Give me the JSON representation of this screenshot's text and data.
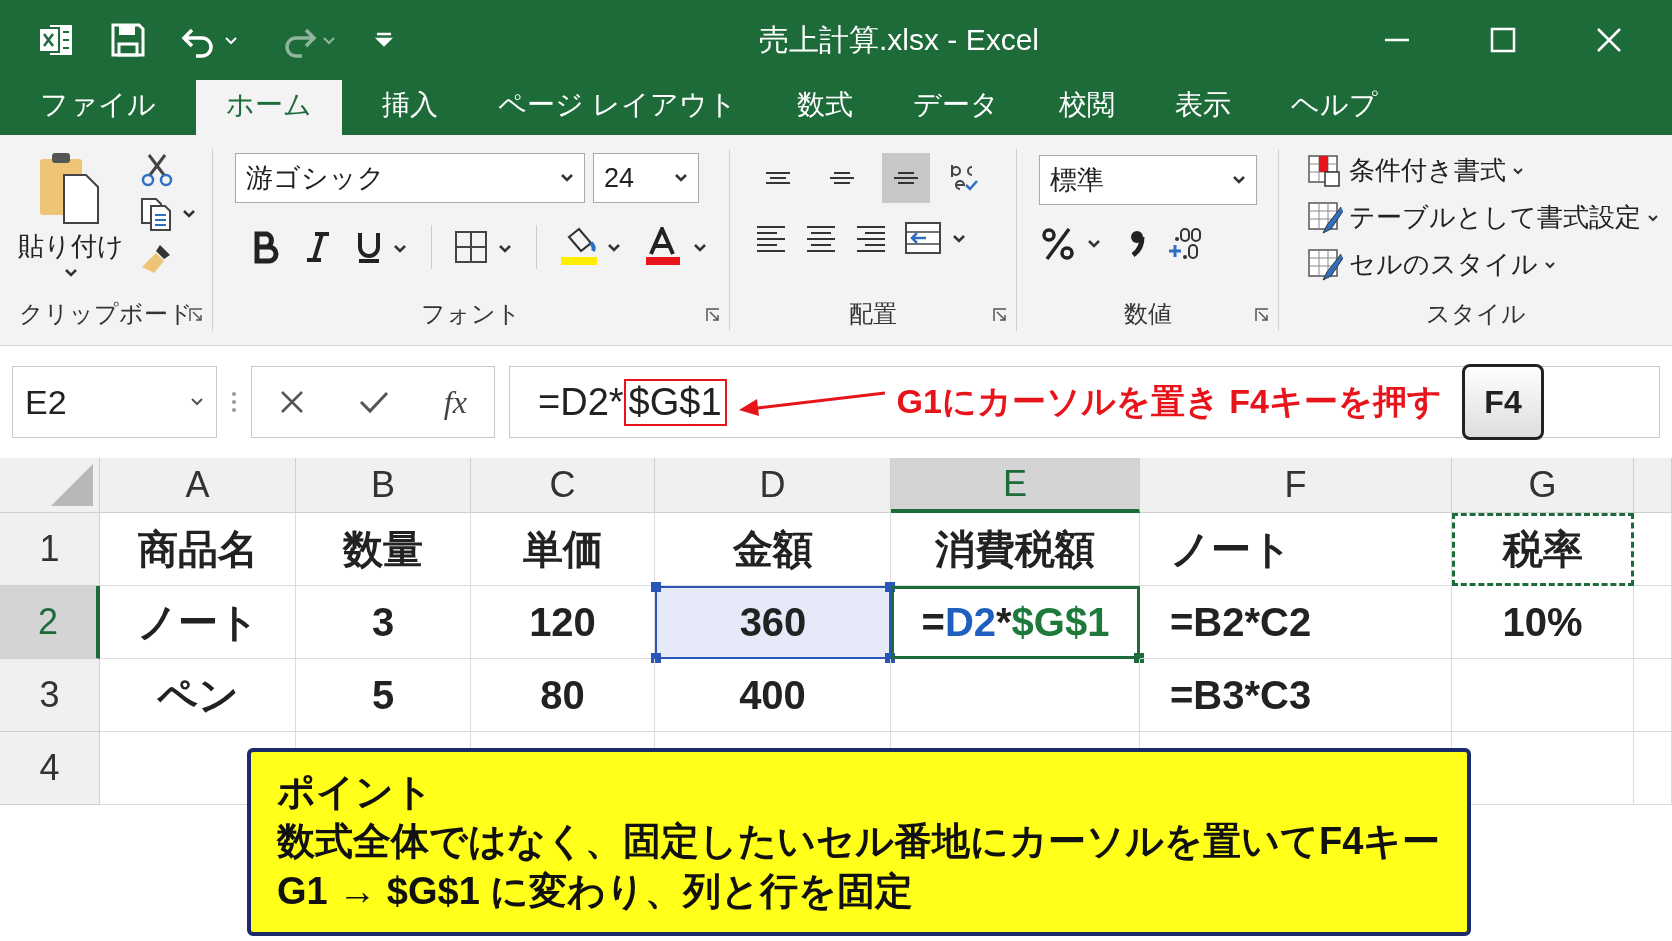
{
  "window": {
    "title": "売上計算.xlsx  -  Excel"
  },
  "ribbon_tabs": [
    {
      "label": "ファイル",
      "selected": false
    },
    {
      "label": "ホーム",
      "selected": true
    },
    {
      "label": "挿入",
      "selected": false
    },
    {
      "label": "ページ レイアウト",
      "selected": false
    },
    {
      "label": "数式",
      "selected": false
    },
    {
      "label": "データ",
      "selected": false
    },
    {
      "label": "校閲",
      "selected": false
    },
    {
      "label": "表示",
      "selected": false
    },
    {
      "label": "ヘルプ",
      "selected": false
    }
  ],
  "ribbon": {
    "clipboard": {
      "paste_label": "貼り付け",
      "group_label": "クリップボード"
    },
    "font": {
      "font_name": "游ゴシック",
      "font_size": "24",
      "group_label": "フォント"
    },
    "alignment": {
      "vertical_align": [
        {
          "selected": false
        },
        {
          "selected": false
        },
        {
          "selected": true
        }
      ],
      "group_label": "配置"
    },
    "number": {
      "format": "標準",
      "group_label": "数値"
    },
    "styles": {
      "items": [
        "条件付き書式",
        "テーブルとして書式設定",
        "セルのスタイル"
      ],
      "group_label": "スタイル"
    }
  },
  "formula_bar": {
    "name_box": "E2",
    "function_label": "fx",
    "formula_prefix": "=D2*",
    "formula_highlight": "$G$1",
    "annotation": "G1にカーソルを置き F4キーを押す",
    "key_label": "F4"
  },
  "sheet": {
    "columns": [
      {
        "label": "A",
        "selected": false
      },
      {
        "label": "B",
        "selected": false
      },
      {
        "label": "C",
        "selected": false
      },
      {
        "label": "D",
        "selected": false
      },
      {
        "label": "E",
        "selected": true
      },
      {
        "label": "F",
        "selected": false
      },
      {
        "label": "G",
        "selected": false
      }
    ],
    "rows": [
      {
        "label": "1",
        "selected": false,
        "cells": [
          {
            "text": "商品名",
            "kind": "plain"
          },
          {
            "text": "数量",
            "kind": "plain"
          },
          {
            "text": "単価",
            "kind": "plain"
          },
          {
            "text": "金額",
            "kind": "plain"
          },
          {
            "text": "消費税額",
            "kind": "plain"
          },
          {
            "text": "ノート",
            "kind": "plain"
          },
          {
            "text": "税率",
            "kind": "marquee"
          }
        ]
      },
      {
        "label": "2",
        "selected": true,
        "cells": [
          {
            "text": "ノート",
            "kind": "plain"
          },
          {
            "text": "3",
            "kind": "plain"
          },
          {
            "text": "120",
            "kind": "plain"
          },
          {
            "text": "360",
            "kind": "reference"
          },
          {
            "parts": [
              {
                "text": "=",
                "color": "#222222"
              },
              {
                "text": "D2",
                "color": "#1f5fbf"
              },
              {
                "text": "*",
                "color": "#222222"
              },
              {
                "text": "$G$1",
                "color": "#1e7a3a"
              }
            ],
            "kind": "active"
          },
          {
            "text": "=B2*C2",
            "kind": "plain"
          },
          {
            "text": "10%",
            "kind": "plain"
          }
        ]
      },
      {
        "label": "3",
        "selected": false,
        "cells": [
          {
            "text": "ペン",
            "kind": "plain"
          },
          {
            "text": "5",
            "kind": "plain"
          },
          {
            "text": "80",
            "kind": "plain"
          },
          {
            "text": "400",
            "kind": "plain"
          },
          {
            "kind": "plain"
          },
          {
            "text": "=B3*C3",
            "kind": "plain"
          },
          {
            "kind": "plain"
          }
        ]
      },
      {
        "label": "4",
        "selected": false,
        "cells": [
          {
            "kind": "plain"
          },
          {
            "kind": "plain"
          },
          {
            "kind": "plain"
          },
          {
            "kind": "plain"
          },
          {
            "kind": "plain"
          },
          {
            "kind": "plain"
          },
          {
            "kind": "plain"
          }
        ]
      }
    ]
  },
  "callout": {
    "title": "ポイント",
    "lines": [
      "数式全体ではなく、固定したいセル番地にカーソルを置いてF4キー",
      "G1 → $G$1 に変わり、列と行を固定"
    ]
  }
}
